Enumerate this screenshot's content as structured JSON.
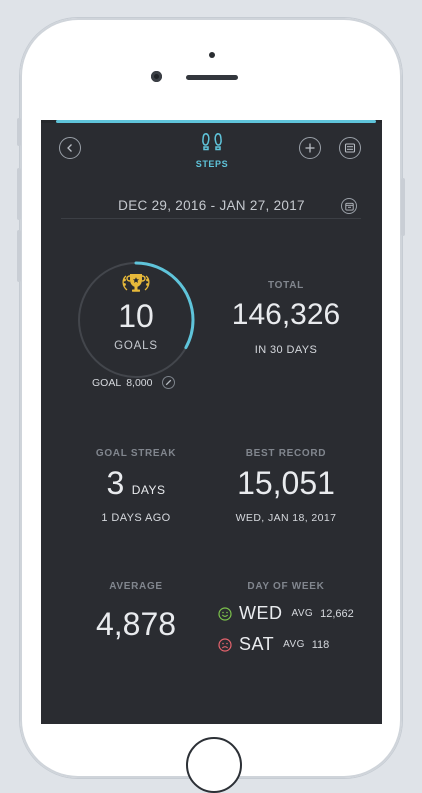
{
  "header": {
    "title": "STEPS",
    "back_icon": "chevron-left-icon",
    "add_icon": "plus-icon",
    "list_icon": "list-icon",
    "title_icon": "footsteps-icon",
    "accent_color": "#5fc4da"
  },
  "date_range": {
    "label": "DEC 29, 2016 - JAN 27, 2017",
    "calendar_icon": "calendar-icon"
  },
  "goals": {
    "count": "10",
    "label": "GOALS",
    "icon": "trophy-icon",
    "progress_fraction": 0.33,
    "goal_label": "GOAL",
    "goal_value": "8,000",
    "edit_icon": "pencil-icon"
  },
  "total": {
    "title": "TOTAL",
    "value": "146,326",
    "sub": "IN 30 DAYS"
  },
  "goal_streak": {
    "title": "GOAL STREAK",
    "value": "3",
    "unit": "DAYS",
    "sub": "1 DAYS AGO"
  },
  "best_record": {
    "title": "BEST RECORD",
    "value": "15,051",
    "sub": "WED, JAN 18, 2017"
  },
  "average": {
    "title": "AVERAGE",
    "value": "4,878"
  },
  "day_of_week": {
    "title": "DAY OF WEEK",
    "best": {
      "icon": "smile-face-icon",
      "color": "#7cc24c",
      "day": "WED",
      "avg_label": "AVG",
      "avg_value": "12,662"
    },
    "worst": {
      "icon": "sad-face-icon",
      "color": "#e5636d",
      "day": "SAT",
      "avg_label": "AVG",
      "avg_value": "118"
    }
  }
}
